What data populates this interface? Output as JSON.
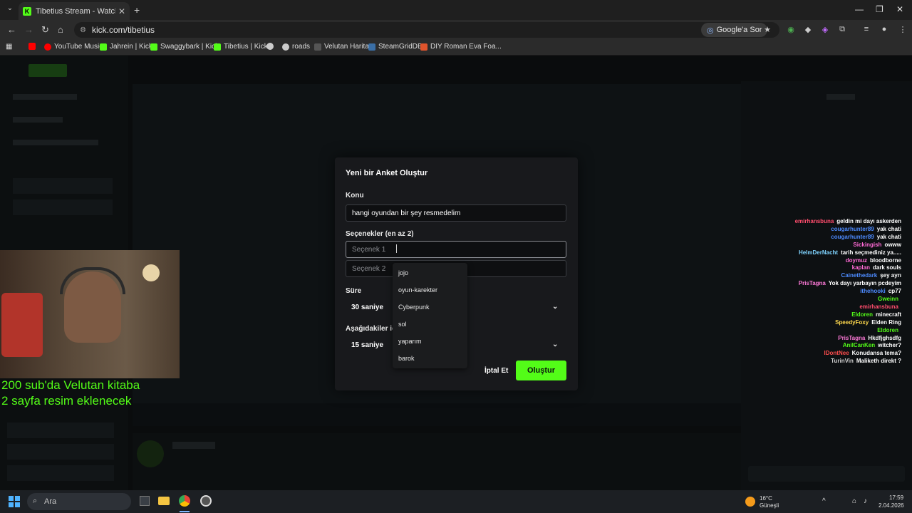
{
  "browser": {
    "tab_title": "Tibetius Stream - Watch Live on Kick",
    "tab_close": "✕",
    "new_tab": "+",
    "url": "kick.com/tibetius",
    "ask_google": "Google'a Sor",
    "bookmarks": [
      {
        "label": "",
        "color": "#ff0000"
      },
      {
        "label": "YouTube Music",
        "color": "#ff0000"
      },
      {
        "label": "Jahrein | Kick",
        "color": "#53fc18"
      },
      {
        "label": "Swaggybark | Kick",
        "color": "#53fc18"
      },
      {
        "label": "Tibetius | Kick",
        "color": "#53fc18"
      },
      {
        "label": "",
        "color": "#cccccc"
      },
      {
        "label": "roads",
        "color": "#cccccc"
      },
      {
        "label": "Velutan Harita",
        "color": "#555555"
      },
      {
        "label": "SteamGridDB",
        "color": "#3a6ea5"
      },
      {
        "label": "DIY Roman Eva Foa...",
        "color": "#e0542c"
      }
    ]
  },
  "webcam_overlay": {
    "line1": "200 sub'da Velutan kitaba",
    "line2": " 2 sayfa resim eklenecek"
  },
  "modal": {
    "title": "Yeni bir Anket Oluştur",
    "topic_label": "Konu",
    "topic_value": "hangi oyundan bir şey resmedelim",
    "options_label": "Seçenekler (en az 2)",
    "option1_placeholder": "Seçenek 1",
    "option2_placeholder": "Seçenek 2",
    "duration_label": "Süre",
    "duration_value": "30 saniye",
    "display_label": "Aşağıdakiler iç",
    "display_value": "15 saniye",
    "cancel": "İptal Et",
    "create": "Oluştur"
  },
  "autocomplete": [
    "jojo",
    "oyun-karekter",
    "Cyberpunk",
    "sol",
    "yaparım",
    "barok"
  ],
  "chat": [
    {
      "user": "emirhansbuna",
      "msg": "geldin mi dayı askerden",
      "color": "#ff4d6d"
    },
    {
      "user": "cougarhunter89",
      "msg": "yak chati",
      "color": "#4d8bff"
    },
    {
      "user": "cougarhunter89",
      "msg": "yak chati",
      "color": "#4d8bff"
    },
    {
      "user": "Sickingish",
      "msg": "owww",
      "color": "#ff6ad5"
    },
    {
      "user": "HelmDerNacht",
      "msg": "tarih seçmediniz ya.....",
      "color": "#7fd4ff"
    },
    {
      "user": "doymuz",
      "msg": "bloodborne",
      "color": "#ff6ad5"
    },
    {
      "user": "kaplan",
      "msg": "dark souls",
      "color": "#ff6ad5"
    },
    {
      "user": "Cainethedark",
      "msg": "şey ayrı",
      "color": "#4d8bff"
    },
    {
      "user": "PrisTagna",
      "msg": "Yok dayı yarbayın pcdeyim",
      "color": "#ff7ad9"
    },
    {
      "user": "ithehooki",
      "msg": "cp77",
      "color": "#4d8bff"
    },
    {
      "user": "Gweinn",
      "msg": "",
      "color": "#53fc18"
    },
    {
      "user": "emirhansbuna",
      "msg": "",
      "color": "#ff4d6d"
    },
    {
      "user": "Eldoren",
      "msg": "minecraft",
      "color": "#53fc18"
    },
    {
      "user": "SpeedyFoxy",
      "msg": "Elden Ring",
      "color": "#ffd94d"
    },
    {
      "user": "Eldoren",
      "msg": "",
      "color": "#53fc18"
    },
    {
      "user": "PrisTagna",
      "msg": "Hkdfjghsdfg",
      "color": "#ff7ad9"
    },
    {
      "user": "AnilCanKen",
      "msg": "witcher?",
      "color": "#53fc18"
    },
    {
      "user": "IDontNee",
      "msg": "Konudansa tema?",
      "color": "#ff4d4d"
    },
    {
      "user": "TurinVin",
      "msg": "Maliketh direkt ?",
      "color": "#cfcfcf"
    }
  ],
  "taskbar": {
    "search": "Ara",
    "weather_temp": "16°C",
    "weather_desc": "Güneşli",
    "time": "17:59",
    "date": "2.04.2026"
  }
}
